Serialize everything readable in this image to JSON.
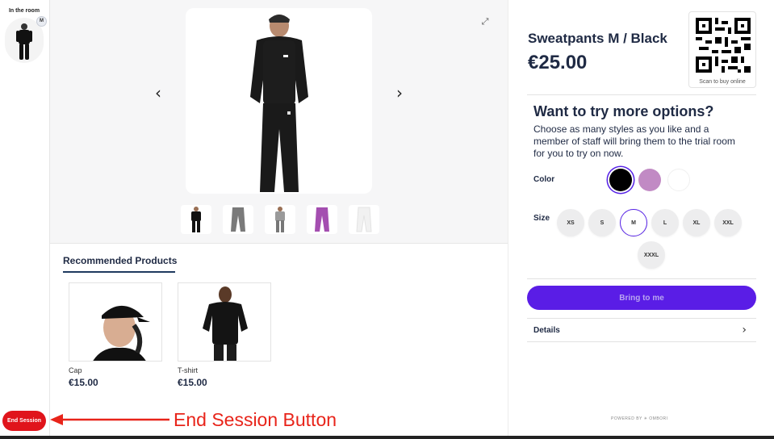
{
  "rail": {
    "title": "In the room",
    "badge": "M",
    "end_session_label": "End Session"
  },
  "annotation": {
    "label": "End Session Button",
    "color": "#e8241a"
  },
  "gallery": {
    "thumbnails": [
      "black-sweatpants-model",
      "grey-sweatpants",
      "grey-sweatpants-model",
      "purple-sweatpants",
      "white-sweatpants"
    ]
  },
  "recommended": {
    "title": "Recommended Products",
    "items": [
      {
        "name": "Cap",
        "price": "€15.00"
      },
      {
        "name": "T-shirt",
        "price": "€15.00"
      }
    ]
  },
  "product": {
    "title": "Sweatpants M / Black",
    "price": "€25.00",
    "qr_caption": "Scan to buy online"
  },
  "options": {
    "title": "Want to try more options?",
    "description": "Choose as many styles as you like and a member of staff will bring them to the trial room for you to try on now.",
    "color_label": "Color",
    "colors": [
      {
        "name": "black",
        "hex": "#000000",
        "selected": true
      },
      {
        "name": "purple",
        "hex": "#c18ac4",
        "selected": false
      },
      {
        "name": "white",
        "hex": "#ffffff",
        "selected": false
      }
    ],
    "size_label": "Size",
    "sizes": [
      "XS",
      "S",
      "M",
      "L",
      "XL",
      "XXL",
      "XXXL"
    ],
    "selected_size": "M"
  },
  "actions": {
    "bring_label": "Bring to me",
    "details_label": "Details"
  },
  "footer": {
    "powered_by": "POWERED BY ✳ OMBORI"
  },
  "colors": {
    "accent": "#5a1de6",
    "danger": "#e0141b",
    "text": "#1f2a44"
  }
}
